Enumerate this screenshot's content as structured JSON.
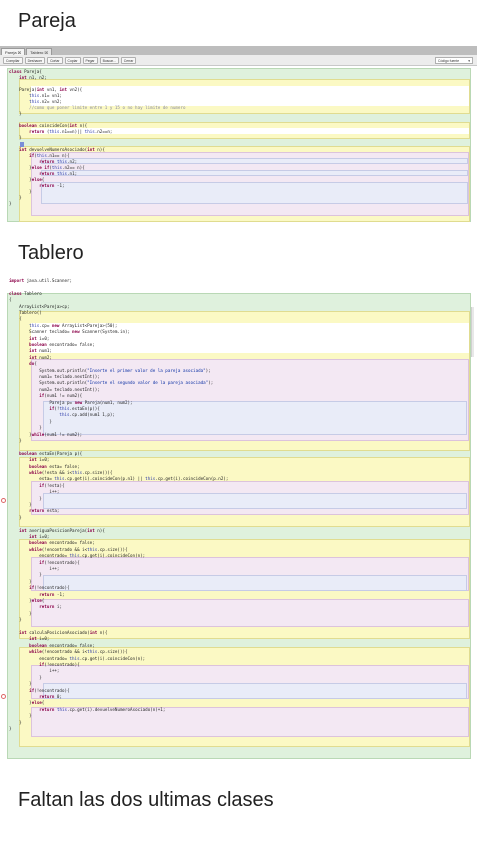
{
  "headings": {
    "pareja": "Pareja",
    "tablero": "Tablero",
    "faltan": "Faltan las dos ultimas clases"
  },
  "pareja_editor": {
    "tabs": [
      "Pareja ☒",
      "Tablero ☒"
    ],
    "toolbar": [
      "Compilar",
      "Deshacer",
      "Cortar",
      "Copiar",
      "Pegar",
      "Buscar...",
      "Cerrar"
    ],
    "view_select": "Código fuente",
    "lines": [
      "class Pareja{",
      "    int n1, n2;",
      "",
      "    Pareja(int vn1, int vn2){",
      "        this.n1= vn1;",
      "        this.n2= vn2;",
      "        //como que poner limite entre 1 y 15 o no hay limite de numero",
      "    }",
      "",
      "    boolean coincideCon(int n){",
      "        return (this.n1==n)|| this.n2==n;",
      "    }",
      "",
      "    int devuelveNumeroAsociado(int n){",
      "        if(this.n1== n){",
      "            return this.n2;",
      "        }else if(this.n2== n){",
      "            return this.n1;",
      "        }else{",
      "            return -1;",
      "        }",
      "    }",
      "}"
    ]
  },
  "tablero_editor": {
    "lines": [
      "import java.util.Scanner;",
      "",
      "class Tablero",
      "{",
      "    ArrayList<Pareja>cp;",
      "    Tablero()",
      "    {",
      "        this.cp= new ArrayList<Pareja>(50);",
      "        Scanner teclado= new Scanner(System.in);",
      "        int i=0;",
      "        boolean encontrado= false;",
      "        int num1;",
      "        int num2;",
      "        do{",
      "            System.out.println(\"Inserte el primer valor de la pareja asociada\");",
      "            num1= teclado.nextInt();",
      "            System.out.println(\"Inserte el segundo valor de la pareja asociada\");",
      "            num2= teclado.nextInt();",
      "            if(num1 != num2){",
      "                Pareja p= new Pareja(num1, num2);",
      "                if(!this.estaEn(p)){",
      "                    this.cp.add(num1 1,p);",
      "                }",
      "            }",
      "        }while(num1 != num2);",
      "    }",
      "",
      "    boolean estaEn(Pareja p){",
      "        int i=0;",
      "        boolean esta= false;",
      "        while(!esta && i<this.cp.size()){",
      "            esta= this.cp.get(i).coincideCon(p.n1) || this.cp.get(i).coincideCon(p.n2);",
      "            if(!esta){",
      "                i++;",
      "            }",
      "        }",
      "        return esta;",
      "    }",
      "",
      "    int averiguaPosicionPareja(int n){",
      "        int i=0;",
      "        boolean encontrado= false;",
      "        while(!encontrado && i<this.cp.size()){",
      "            encontrado= this.cp.get(i).coincideCon(n);",
      "            if(!encontrado){",
      "                i++;",
      "            }",
      "        }",
      "        if(!encontrado){",
      "            return -1;",
      "        }else{",
      "            return i;",
      "        }",
      "    }",
      "",
      "    int calculaPosicionAsociado(int n){",
      "        int i=0;",
      "        boolean encontrado= false;",
      "        while(!encontrado && i<this.cp.size()){",
      "            encontrado= this.cp.get(i).coincideCon(n);",
      "            if(!encontrado){",
      "                i++;",
      "            }",
      "        }",
      "        if(!encontrado){",
      "            return 0;",
      "        }else{",
      "            return this.cp.get(i).devuelveNumeroAsociado(n)+1;",
      "        }",
      "    }",
      "}"
    ]
  }
}
